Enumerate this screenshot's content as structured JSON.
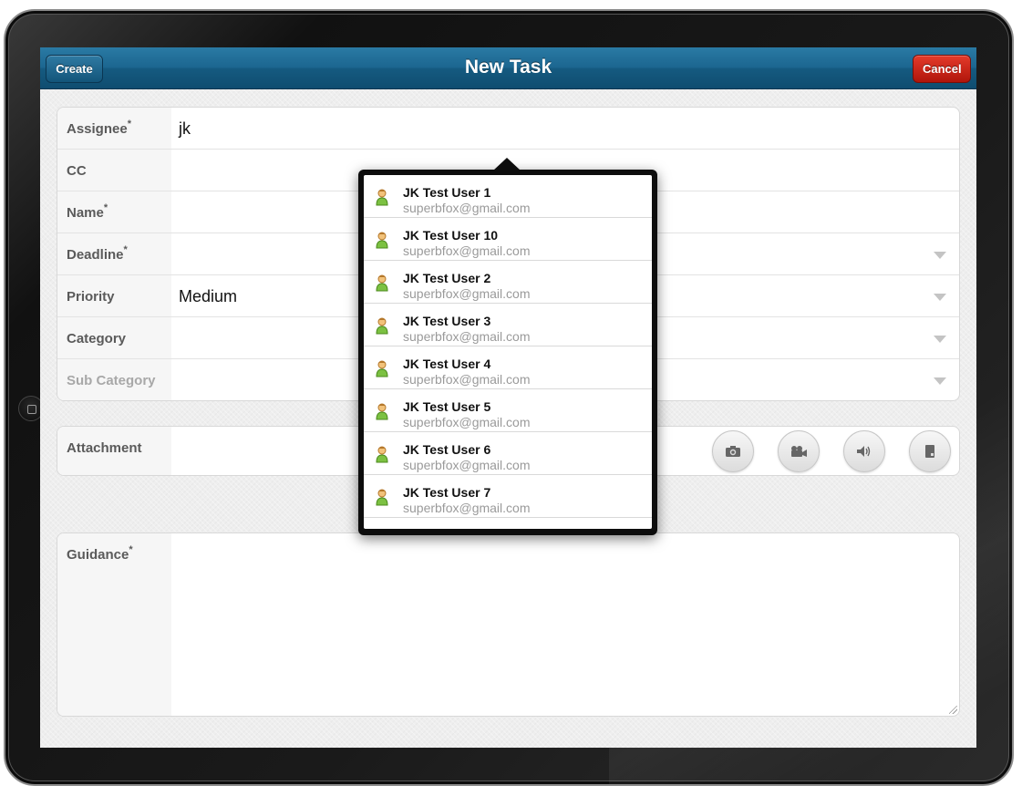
{
  "navbar": {
    "title": "New Task",
    "create_label": "Create",
    "cancel_label": "Cancel"
  },
  "form": {
    "fields": [
      {
        "label": "Assignee",
        "required": "*",
        "value": "jk",
        "dropdown": false
      },
      {
        "label": "CC",
        "required": "",
        "value": "",
        "dropdown": false
      },
      {
        "label": "Name",
        "required": "*",
        "value": "",
        "dropdown": false
      },
      {
        "label": "Deadline",
        "required": "*",
        "value": "",
        "dropdown": true
      },
      {
        "label": "Priority",
        "required": "",
        "value": "Medium",
        "dropdown": true
      },
      {
        "label": "Category",
        "required": "",
        "value": "",
        "dropdown": true
      },
      {
        "label": "Sub Category",
        "required": "",
        "value": "",
        "dropdown": true
      }
    ],
    "attachment": {
      "label": "Attachment",
      "buttons": [
        "camera-icon",
        "video-camera-icon",
        "audio-icon",
        "document-icon"
      ]
    },
    "guidance": {
      "label": "Guidance",
      "required": "*",
      "value": ""
    }
  },
  "suggestions": [
    {
      "name": "JK Test User 1",
      "email": "superbfox@gmail.com"
    },
    {
      "name": "JK Test User 10",
      "email": "superbfox@gmail.com"
    },
    {
      "name": "JK Test User 2",
      "email": "superbfox@gmail.com"
    },
    {
      "name": "JK Test User 3",
      "email": "superbfox@gmail.com"
    },
    {
      "name": "JK Test User 4",
      "email": "superbfox@gmail.com"
    },
    {
      "name": "JK Test User 5",
      "email": "superbfox@gmail.com"
    },
    {
      "name": "JK Test User 6",
      "email": "superbfox@gmail.com"
    },
    {
      "name": "JK Test User 7",
      "email": "superbfox@gmail.com"
    }
  ],
  "colors": {
    "navbar": "#1c6690",
    "create_button": "#13557a",
    "cancel_button": "#c8190d"
  }
}
